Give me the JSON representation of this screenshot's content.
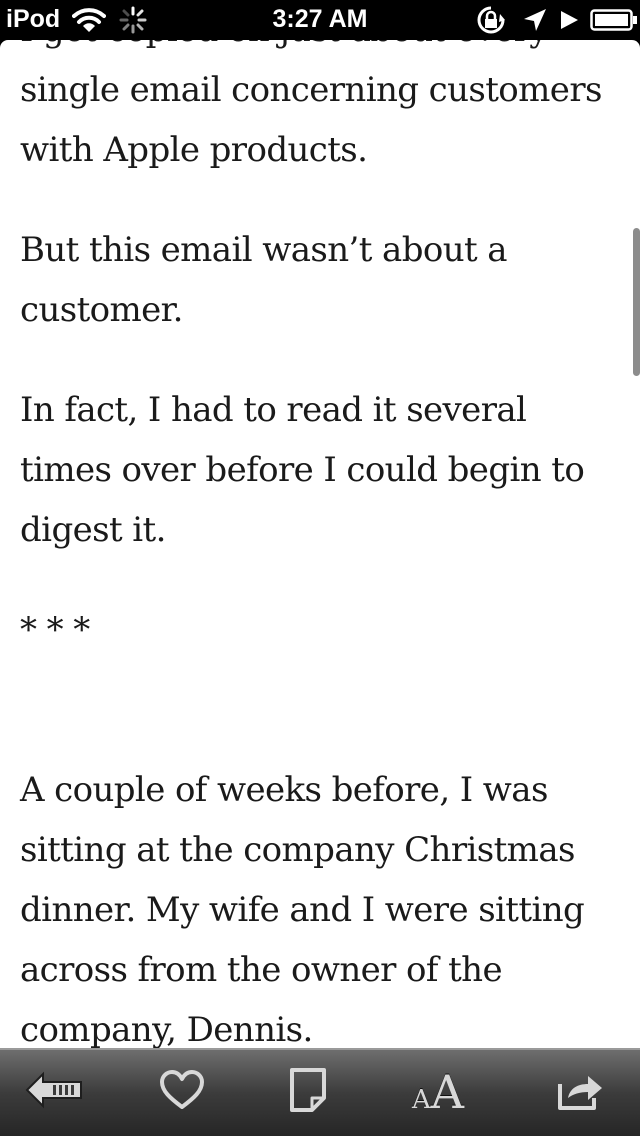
{
  "status_bar": {
    "carrier": "iPod",
    "time": "3:27 AM",
    "icons": [
      "wifi-icon",
      "activity-spinner-icon",
      "rotation-lock-icon",
      "location-icon",
      "play-icon",
      "battery-icon"
    ]
  },
  "article": {
    "paragraphs": [
      "I got copied on just about every single email concerning customers with Apple products.",
      "But this email wasn’t about a customer.",
      "In fact, I had to read it several times over before I could begin to digest it.",
      "* * *",
      "A couple of weeks before, I was sitting at the company Christmas dinner. My wife and I were sitting across from the owner of the company, Dennis."
    ]
  },
  "toolbar": {
    "font_small": "A",
    "font_large": "A",
    "icons": [
      "back-icon",
      "heart-icon",
      "note-icon",
      "font-size-icon",
      "share-icon"
    ]
  },
  "colors": {
    "page_background": "#ffffff",
    "text": "#1a1a1a",
    "status_bar": "#000000",
    "toolbar_top": "#6e6e6e",
    "toolbar_bottom": "#262626"
  }
}
